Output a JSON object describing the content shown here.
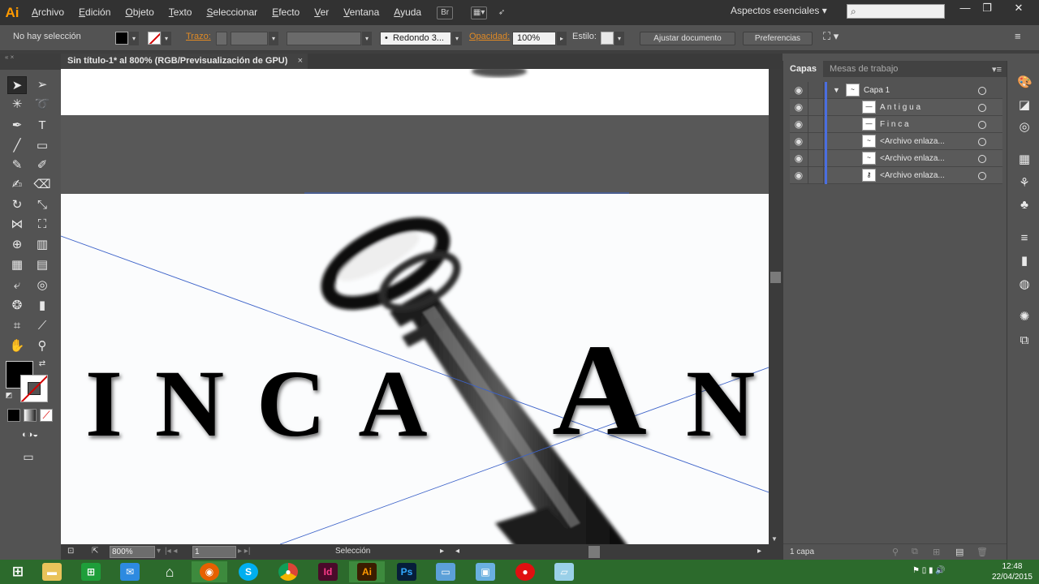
{
  "app": {
    "logo": "Ai",
    "workspace": "Aspectos esenciales",
    "search_placeholder": ""
  },
  "menu": [
    "Archivo",
    "Edición",
    "Objeto",
    "Texto",
    "Seleccionar",
    "Efecto",
    "Ver",
    "Ventana",
    "Ayuda"
  ],
  "window_controls": {
    "minimize": "—",
    "restore": "❐",
    "close": "✕"
  },
  "controlbar": {
    "selection": "No hay selección",
    "stroke_label": "Trazo:",
    "brush": "Redondo 3...",
    "opacity_label": "Opacidad:",
    "opacity_value": "100%",
    "style_label": "Estilo:",
    "fit_button": "Ajustar documento",
    "prefs_button": "Preferencias"
  },
  "document": {
    "tab_title": "Sin título-1* al 800% (RGB/Previsualización de GPU)",
    "close": "×",
    "zoom": "800%",
    "page": "1",
    "status": "Selección",
    "artwork_text_left": "INCA",
    "artwork_text_right": "AN"
  },
  "layers_panel": {
    "tabs": [
      "Capas",
      "Mesas de trabajo"
    ],
    "rows": [
      {
        "label": "Capa 1",
        "level": 0
      },
      {
        "label": "A n t i g u a",
        "level": 1
      },
      {
        "label": "F i n c a",
        "level": 1
      },
      {
        "label": "<Archivo enlaza...",
        "level": 1
      },
      {
        "label": "<Archivo enlaza...",
        "level": 1
      },
      {
        "label": "<Archivo enlaza...",
        "level": 1
      }
    ],
    "footer": "1 capa"
  },
  "taskbar": {
    "apps": [
      "windows-start",
      "file-explorer",
      "store",
      "outlook",
      "home",
      "firefox",
      "skype",
      "chrome",
      "indesign",
      "illustrator",
      "photoshop",
      "photos",
      "control-panel",
      "record",
      "notes"
    ],
    "time": "12:48",
    "date": "22/04/2015"
  },
  "colors": {
    "accent_orange": "#ff9a00",
    "taskbar": "#2c6a2c",
    "layer_bar": "#4a6ee0",
    "canvas_band": "#585858"
  }
}
